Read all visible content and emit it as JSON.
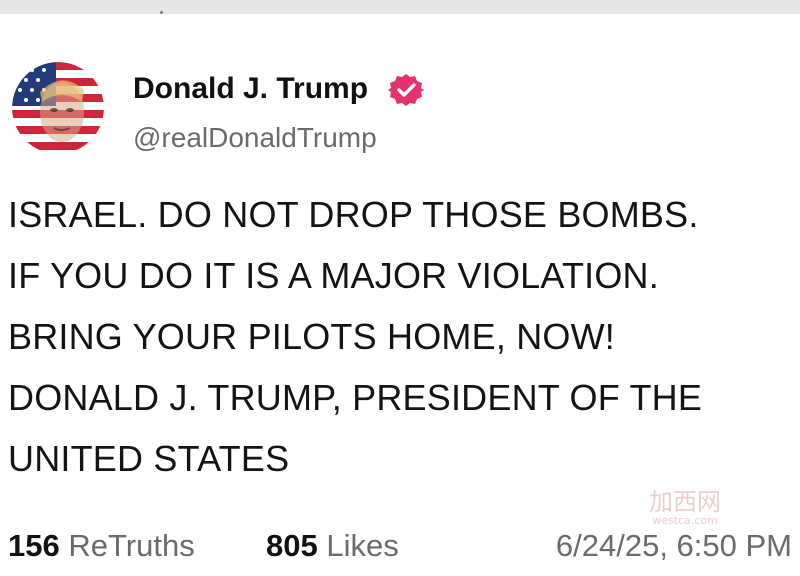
{
  "post": {
    "author": {
      "display_name": "Donald J. Trump",
      "handle": "@realDonaldTrump",
      "verified": true,
      "avatar_icon": "flag-portrait-avatar",
      "badge_color": "#e5336b"
    },
    "text_lines": [
      "ISRAEL. DO NOT DROP THOSE BOMBS.",
      "IF YOU DO IT IS A MAJOR VIOLATION.",
      "BRING YOUR PILOTS HOME, NOW!",
      "DONALD J. TRUMP, PRESIDENT OF THE",
      "UNITED STATES"
    ],
    "stats": {
      "retruths_count": "156",
      "retruths_label": "ReTruths",
      "likes_count": "805",
      "likes_label": "Likes"
    },
    "timestamp": "6/24/25, 6:50 PM"
  },
  "watermark": {
    "brand": "加西网",
    "domain": "westca.com"
  }
}
